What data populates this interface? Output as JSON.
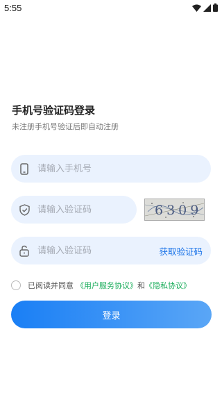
{
  "status_bar": {
    "time": "5:55"
  },
  "header": {
    "title": "手机号验证码登录",
    "subtitle": "未注册手机号验证后即自动注册"
  },
  "form": {
    "phone_placeholder": "请输入手机号",
    "captcha_placeholder": "请输入验证码",
    "captcha_image_text": "6309",
    "sms_placeholder": "请输入验证码",
    "sms_button": "获取验证码"
  },
  "agreement": {
    "prefix": "已阅读并同意",
    "user_agreement": "《用户服务协议》",
    "conjunction": "和",
    "privacy_policy": "《隐私协议》"
  },
  "login_button": "登录",
  "colors": {
    "accent": "#1a73e8",
    "link_green": "#1aad5b",
    "field_bg": "#eaf2fe"
  },
  "icons": [
    "wifi-icon",
    "signal-icon",
    "battery-icon",
    "phone-icon",
    "shield-check-icon",
    "lock-icon"
  ]
}
